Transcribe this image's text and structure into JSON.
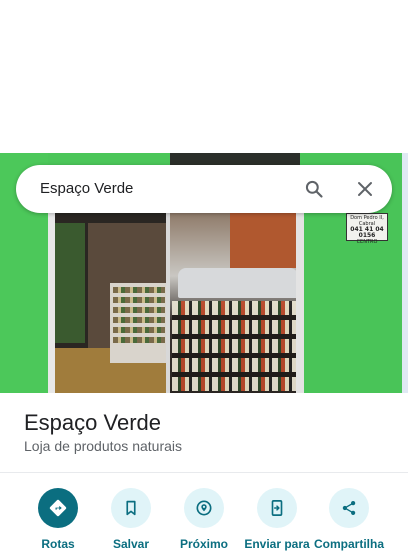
{
  "search": {
    "query": "Espaço Verde"
  },
  "photo": {
    "sign_line1": "Dom Pedro II, Cabral",
    "sign_line2": "041 41 04 0156",
    "sign_line3": "CENTRO"
  },
  "place": {
    "name": "Espaço Verde",
    "category": "Loja de produtos naturais"
  },
  "actions": [
    {
      "label": "Rotas",
      "icon": "directions-icon"
    },
    {
      "label": "Salvar",
      "icon": "bookmark-icon"
    },
    {
      "label": "Próximo",
      "icon": "nearby-icon"
    },
    {
      "label": "Enviar para",
      "icon": "send-to-phone-icon"
    },
    {
      "label": "Compartilha",
      "icon": "share-icon"
    }
  ],
  "colors": {
    "accent": "#0b6e80",
    "accent_light": "#e0f4f8",
    "storefront_green": "#4bc659"
  }
}
